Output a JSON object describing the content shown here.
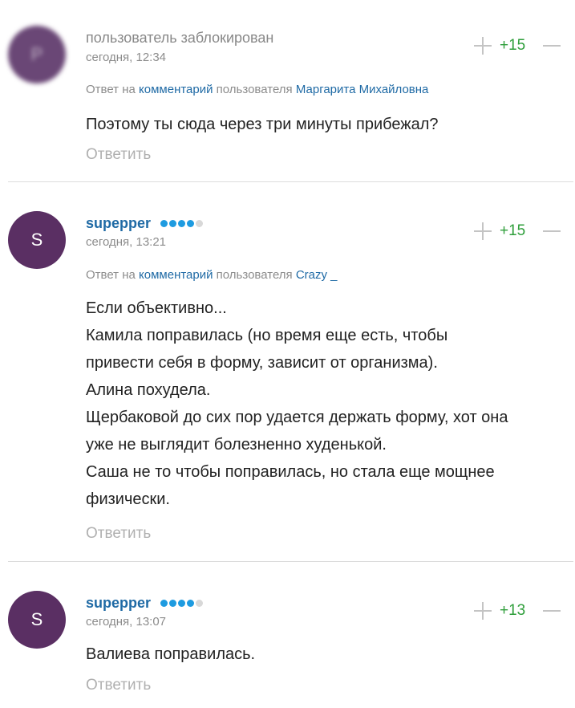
{
  "comments": [
    {
      "avatar_letter": "P",
      "username": "пользователь заблокирован",
      "date": "сегодня, 12:34",
      "score": "+15",
      "reply": {
        "prefix": "Ответ на",
        "link": "комментарий",
        "middle": "пользователя",
        "user": "Маргарита Михайловна"
      },
      "lines": [
        "Поэтому ты сюда через три минуты прибежал?"
      ],
      "answer_label": "Ответить"
    },
    {
      "avatar_letter": "S",
      "username": "supepper",
      "date": "сегодня, 13:21",
      "score": "+15",
      "reply": {
        "prefix": "Ответ на",
        "link": "комментарий",
        "middle": "пользователя",
        "user": "Crazy _"
      },
      "lines": [
        "Если объективно...",
        "Камила поправилась (но время еще есть, чтобы",
        "привести себя в форму, зависит от организма).",
        "Алина похудела.",
        "Щербаковой до сих пор удается держать форму, хот она",
        "уже не выглядит болезненно худенькой.",
        "Саша не то чтобы поправилась, но стала еще мощнее",
        "физически."
      ],
      "answer_label": "Ответить"
    },
    {
      "avatar_letter": "S",
      "username": "supepper",
      "date": "сегодня, 13:07",
      "score": "+13",
      "lines": [
        "Валиева поправилась."
      ],
      "answer_label": "Ответить"
    }
  ],
  "colors": {
    "avatar": "#5a2f63",
    "link": "#1f6aa5",
    "score": "#2e9e3a",
    "rating_on": "#1e9be0"
  }
}
